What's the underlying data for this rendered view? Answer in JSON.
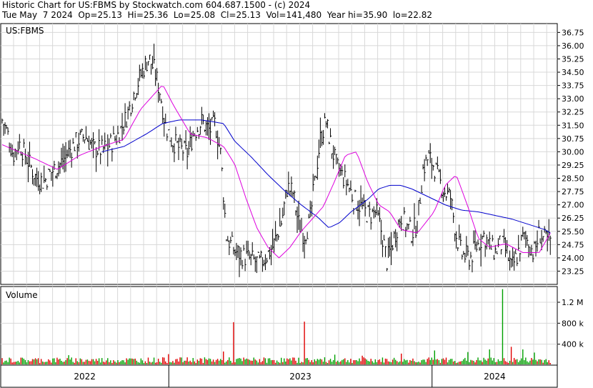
{
  "header": {
    "line1": "Historic Chart for US:FBMS by Stockwatch.com 604.687.1500 - (c) 2024",
    "line2": "Tue May  7 2024  Op=25.13  Hi=25.36  Lo=25.08  Cl=25.13  Vol=141,480  Year hi=35.90  lo=22.82"
  },
  "chart_data": [
    {
      "type": "ohlc",
      "title": "US:FBMS",
      "ylim": [
        22.5,
        37.25
      ],
      "y_ticks": [
        "36.75",
        "36.00",
        "35.25",
        "34.50",
        "33.75",
        "33.00",
        "32.25",
        "31.50",
        "30.75",
        "30.00",
        "29.25",
        "28.50",
        "27.75",
        "27.00",
        "26.25",
        "25.50",
        "24.75",
        "24.00",
        "23.25"
      ],
      "x_labels": [
        "2022",
        "2023",
        "2024"
      ],
      "x_dividers": [
        0.302,
        0.775
      ],
      "colors": {
        "price": "#000000",
        "ma_short": "#dd00dd",
        "ma_long": "#0000cc"
      },
      "price_anchors": [
        [
          0,
          31.8
        ],
        [
          0.01,
          31.0
        ],
        [
          0.02,
          29.8
        ],
        [
          0.03,
          30.5
        ],
        [
          0.045,
          29.6
        ],
        [
          0.06,
          28.6
        ],
        [
          0.075,
          28.3
        ],
        [
          0.09,
          28.9
        ],
        [
          0.105,
          29.3
        ],
        [
          0.12,
          30.0
        ],
        [
          0.135,
          30.6
        ],
        [
          0.15,
          30.9
        ],
        [
          0.165,
          30.2
        ],
        [
          0.18,
          30.1
        ],
        [
          0.195,
          30.4
        ],
        [
          0.21,
          31.0
        ],
        [
          0.225,
          32.0
        ],
        [
          0.24,
          33.5
        ],
        [
          0.255,
          34.7
        ],
        [
          0.265,
          35.3
        ],
        [
          0.275,
          34.6
        ],
        [
          0.285,
          33.4
        ],
        [
          0.295,
          31.5
        ],
        [
          0.305,
          30.7
        ],
        [
          0.32,
          30.2
        ],
        [
          0.335,
          29.9
        ],
        [
          0.345,
          31.0
        ],
        [
          0.36,
          31.7
        ],
        [
          0.375,
          31.2
        ],
        [
          0.385,
          31.6
        ],
        [
          0.395,
          29.8
        ],
        [
          0.405,
          25.2
        ],
        [
          0.42,
          24.4
        ],
        [
          0.435,
          24.1
        ],
        [
          0.45,
          23.9
        ],
        [
          0.465,
          23.7
        ],
        [
          0.475,
          24.0
        ],
        [
          0.49,
          24.7
        ],
        [
          0.505,
          26.1
        ],
        [
          0.515,
          28.0
        ],
        [
          0.525,
          27.7
        ],
        [
          0.535,
          26.0
        ],
        [
          0.545,
          25.3
        ],
        [
          0.555,
          25.9
        ],
        [
          0.565,
          28.4
        ],
        [
          0.575,
          30.8
        ],
        [
          0.585,
          31.7
        ],
        [
          0.595,
          30.2
        ],
        [
          0.605,
          29.1
        ],
        [
          0.615,
          28.6
        ],
        [
          0.625,
          28.1
        ],
        [
          0.635,
          27.3
        ],
        [
          0.645,
          27.0
        ],
        [
          0.655,
          26.6
        ],
        [
          0.665,
          26.4
        ],
        [
          0.675,
          26.6
        ],
        [
          0.685,
          25.5
        ],
        [
          0.695,
          23.8
        ],
        [
          0.7,
          24.3
        ],
        [
          0.71,
          25.4
        ],
        [
          0.72,
          26.4
        ],
        [
          0.73,
          25.8
        ],
        [
          0.74,
          25.4
        ],
        [
          0.75,
          26.0
        ],
        [
          0.76,
          29.0
        ],
        [
          0.77,
          29.7
        ],
        [
          0.78,
          29.2
        ],
        [
          0.79,
          28.3
        ],
        [
          0.8,
          27.7
        ],
        [
          0.81,
          27.4
        ],
        [
          0.82,
          25.3
        ],
        [
          0.83,
          24.2
        ],
        [
          0.845,
          24.0
        ],
        [
          0.86,
          24.8
        ],
        [
          0.87,
          25.3
        ],
        [
          0.88,
          24.7
        ],
        [
          0.89,
          24.3
        ],
        [
          0.9,
          24.8
        ],
        [
          0.91,
          24.4
        ],
        [
          0.92,
          23.4
        ],
        [
          0.93,
          24.1
        ],
        [
          0.94,
          25.1
        ],
        [
          0.95,
          25.0
        ],
        [
          0.96,
          24.2
        ],
        [
          0.97,
          25.4
        ],
        [
          0.98,
          25.0
        ]
      ],
      "ma_short_anchors": [
        [
          0,
          30.4
        ],
        [
          0.06,
          29.6
        ],
        [
          0.1,
          29.0
        ],
        [
          0.14,
          29.8
        ],
        [
          0.18,
          30.3
        ],
        [
          0.22,
          30.7
        ],
        [
          0.25,
          32.4
        ],
        [
          0.29,
          33.8
        ],
        [
          0.31,
          32.6
        ],
        [
          0.34,
          31.0
        ],
        [
          0.37,
          30.8
        ],
        [
          0.4,
          30.3
        ],
        [
          0.42,
          29.3
        ],
        [
          0.44,
          27.4
        ],
        [
          0.46,
          25.7
        ],
        [
          0.48,
          24.6
        ],
        [
          0.5,
          24.0
        ],
        [
          0.52,
          24.6
        ],
        [
          0.54,
          25.5
        ],
        [
          0.56,
          26.2
        ],
        [
          0.58,
          26.9
        ],
        [
          0.6,
          28.3
        ],
        [
          0.62,
          29.8
        ],
        [
          0.64,
          30.0
        ],
        [
          0.66,
          28.3
        ],
        [
          0.68,
          27.0
        ],
        [
          0.7,
          26.6
        ],
        [
          0.72,
          25.6
        ],
        [
          0.75,
          25.4
        ],
        [
          0.78,
          26.6
        ],
        [
          0.8,
          28.1
        ],
        [
          0.82,
          28.7
        ],
        [
          0.84,
          27.0
        ],
        [
          0.86,
          25.1
        ],
        [
          0.88,
          24.6
        ],
        [
          0.91,
          24.8
        ],
        [
          0.94,
          24.3
        ],
        [
          0.97,
          24.3
        ],
        [
          0.99,
          25.4
        ]
      ],
      "ma_long_anchors": [
        [
          0.18,
          30.0
        ],
        [
          0.22,
          30.3
        ],
        [
          0.26,
          31.0
        ],
        [
          0.29,
          31.6
        ],
        [
          0.32,
          31.8
        ],
        [
          0.36,
          31.8
        ],
        [
          0.4,
          31.6
        ],
        [
          0.42,
          30.6
        ],
        [
          0.45,
          29.7
        ],
        [
          0.48,
          28.7
        ],
        [
          0.51,
          27.8
        ],
        [
          0.54,
          27.0
        ],
        [
          0.57,
          26.3
        ],
        [
          0.59,
          25.7
        ],
        [
          0.61,
          26.0
        ],
        [
          0.63,
          26.6
        ],
        [
          0.66,
          27.3
        ],
        [
          0.68,
          27.9
        ],
        [
          0.7,
          28.1
        ],
        [
          0.72,
          28.1
        ],
        [
          0.74,
          27.9
        ],
        [
          0.76,
          27.6
        ],
        [
          0.78,
          27.3
        ],
        [
          0.8,
          27.0
        ],
        [
          0.83,
          26.7
        ],
        [
          0.86,
          26.6
        ],
        [
          0.89,
          26.4
        ],
        [
          0.92,
          26.2
        ],
        [
          0.95,
          25.9
        ],
        [
          0.98,
          25.6
        ],
        [
          0.99,
          25.4
        ]
      ]
    },
    {
      "type": "bar",
      "title": "Volume",
      "ylim": [
        0,
        1500000
      ],
      "y_ticks": [
        "1.2 M",
        "800 k",
        "400 k"
      ],
      "colors": {
        "up": "#00a000",
        "down": "#e00000"
      },
      "spikes": [
        [
          0.417,
          820000,
          "down"
        ],
        [
          0.547,
          830000,
          "down"
        ],
        [
          0.903,
          1450000,
          "up"
        ],
        [
          0.94,
          300000,
          "up"
        ],
        [
          0.72,
          220000,
          "down"
        ],
        [
          0.78,
          280000,
          "up"
        ],
        [
          0.12,
          190000,
          "up"
        ],
        [
          0.3,
          210000,
          "down"
        ],
        [
          0.4,
          260000,
          "down"
        ],
        [
          0.6,
          200000,
          "up"
        ],
        [
          0.65,
          180000,
          "down"
        ],
        [
          0.84,
          250000,
          "up"
        ],
        [
          0.88,
          300000,
          "up"
        ],
        [
          0.92,
          350000,
          "down"
        ],
        [
          0.96,
          240000,
          "up"
        ]
      ]
    }
  ]
}
